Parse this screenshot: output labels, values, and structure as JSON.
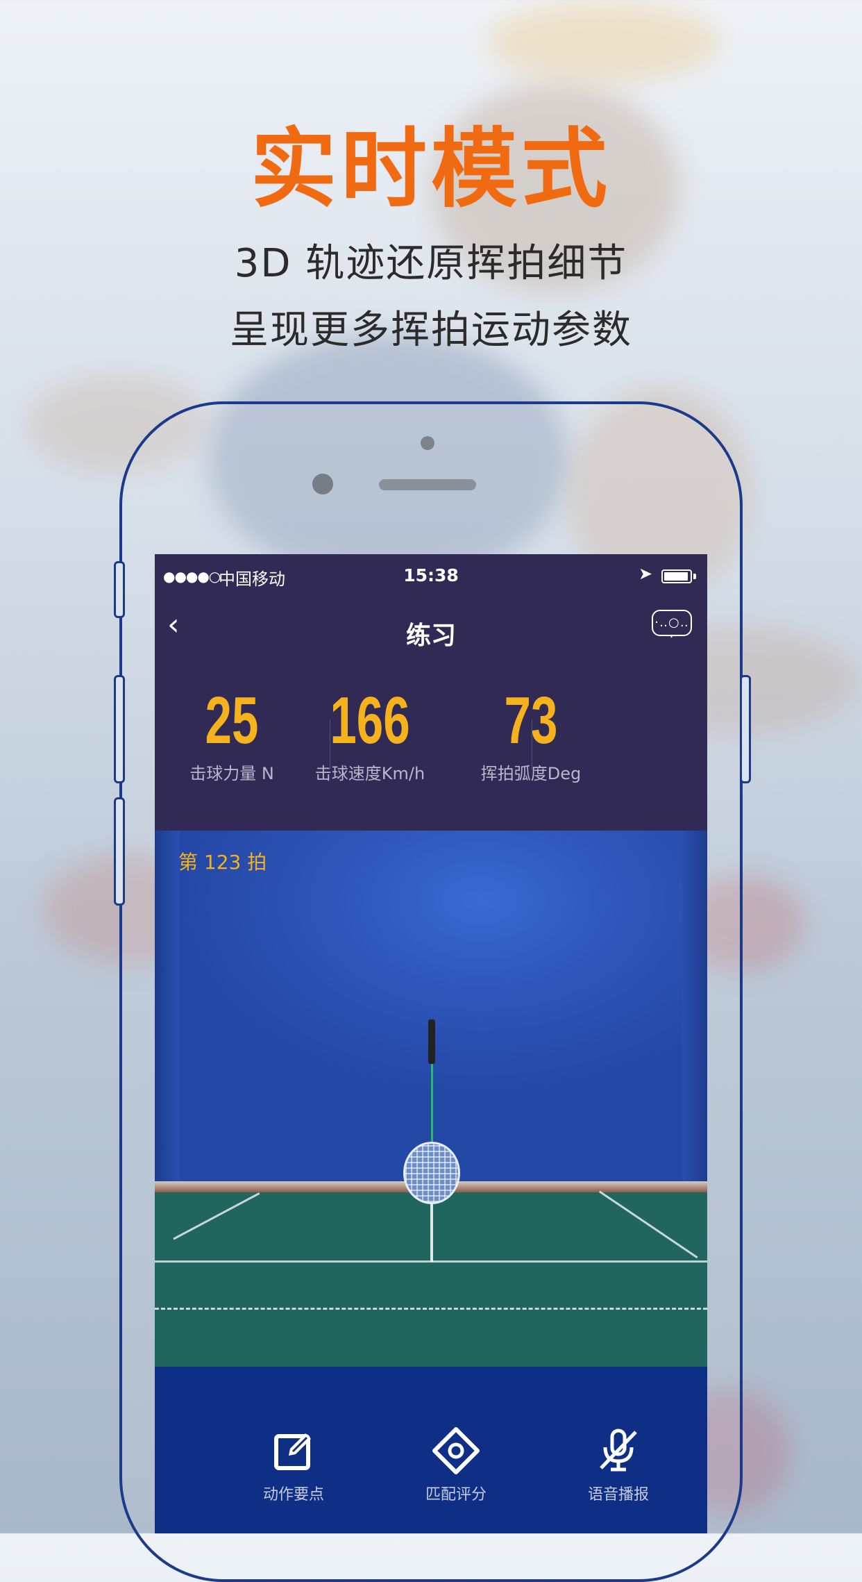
{
  "promo": {
    "headline": "实时模式",
    "subtitle_line1": "3D 轨迹还原挥拍细节",
    "subtitle_line2": "呈现更多挥拍运动参数"
  },
  "status_bar": {
    "signal": "●●●●○",
    "carrier": "中国移动",
    "time": "15:38"
  },
  "nav": {
    "back_icon": "‹",
    "title": "练习",
    "device_icon_text": "·‥○‥·"
  },
  "stats": [
    {
      "value": "25",
      "label": "击球力量 N"
    },
    {
      "value": "166",
      "label": "击球速度Km/h"
    },
    {
      "value": "73",
      "label": "挥拍弧度Deg"
    }
  ],
  "court": {
    "shot_count": "第 123 拍"
  },
  "bottom_actions": [
    {
      "label": "动作要点",
      "icon": "edit-icon"
    },
    {
      "label": "匹配评分",
      "icon": "diamond-target-icon"
    },
    {
      "label": "语音播报",
      "icon": "mic-muted-icon"
    }
  ],
  "colors": {
    "headline": "#f06a12",
    "stat_value": "#f6b21c",
    "screen_bg": "#302a55",
    "bottom_bar": "#0f2f87",
    "court_floor": "#20665e"
  }
}
